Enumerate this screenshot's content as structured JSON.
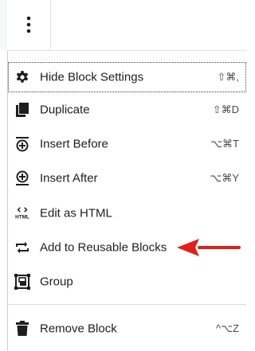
{
  "menu": {
    "items": [
      {
        "label": "Hide Block Settings",
        "shortcut": "⇧⌘,",
        "icon": "gear-icon"
      },
      {
        "label": "Duplicate",
        "shortcut": "⇧⌘D",
        "icon": "duplicate-icon"
      },
      {
        "label": "Insert Before",
        "shortcut": "⌥⌘T",
        "icon": "insert-before-icon"
      },
      {
        "label": "Insert After",
        "shortcut": "⌥⌘Y",
        "icon": "insert-after-icon"
      },
      {
        "label": "Edit as HTML",
        "shortcut": "",
        "icon": "html-icon"
      },
      {
        "label": "Add to Reusable Blocks",
        "shortcut": "",
        "icon": "reusable-icon"
      },
      {
        "label": "Group",
        "shortcut": "",
        "icon": "group-icon"
      },
      {
        "label": "Remove Block",
        "shortcut": "^⌥Z",
        "icon": "trash-icon"
      }
    ],
    "html_icon_text": "HTML"
  },
  "annotation": {
    "arrow_color": "#e0201b"
  }
}
